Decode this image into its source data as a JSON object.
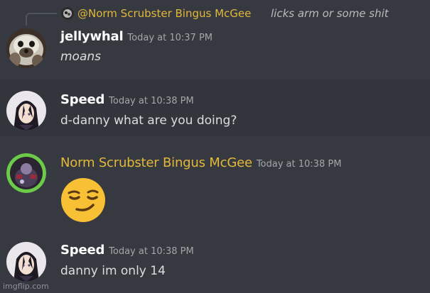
{
  "reply": {
    "mention": "@Norm Scrubster Bingus McGee",
    "text": "licks arm or some shit"
  },
  "messages": [
    {
      "username": "jellywhal",
      "timestamp": "Today at 10:37 PM",
      "content": "moans",
      "avatar_icon": "seal-avatar-icon"
    },
    {
      "username": "Speed",
      "timestamp": "Today at 10:38 PM",
      "content": "d-danny what are you doing?",
      "avatar_icon": "anime-girl-avatar-icon"
    },
    {
      "username": "Norm Scrubster Bingus McGee",
      "timestamp": "Today at 10:38 PM",
      "content": "",
      "emoji": "smirking-face-emoji",
      "username_color": "#e3b83b",
      "avatar_icon": "gamer-avatar-icon"
    },
    {
      "username": "Speed",
      "timestamp": "Today at 10:38 PM",
      "content": "danny im only 14",
      "avatar_icon": "anime-girl-avatar-icon"
    }
  ],
  "watermark": "imgflip.com",
  "colors": {
    "background": "#36393f",
    "highlight": "#32353b",
    "username": "#ffffff",
    "gold": "#e3b83b",
    "text": "#dcddde",
    "timestamp": "#a3a6aa"
  }
}
